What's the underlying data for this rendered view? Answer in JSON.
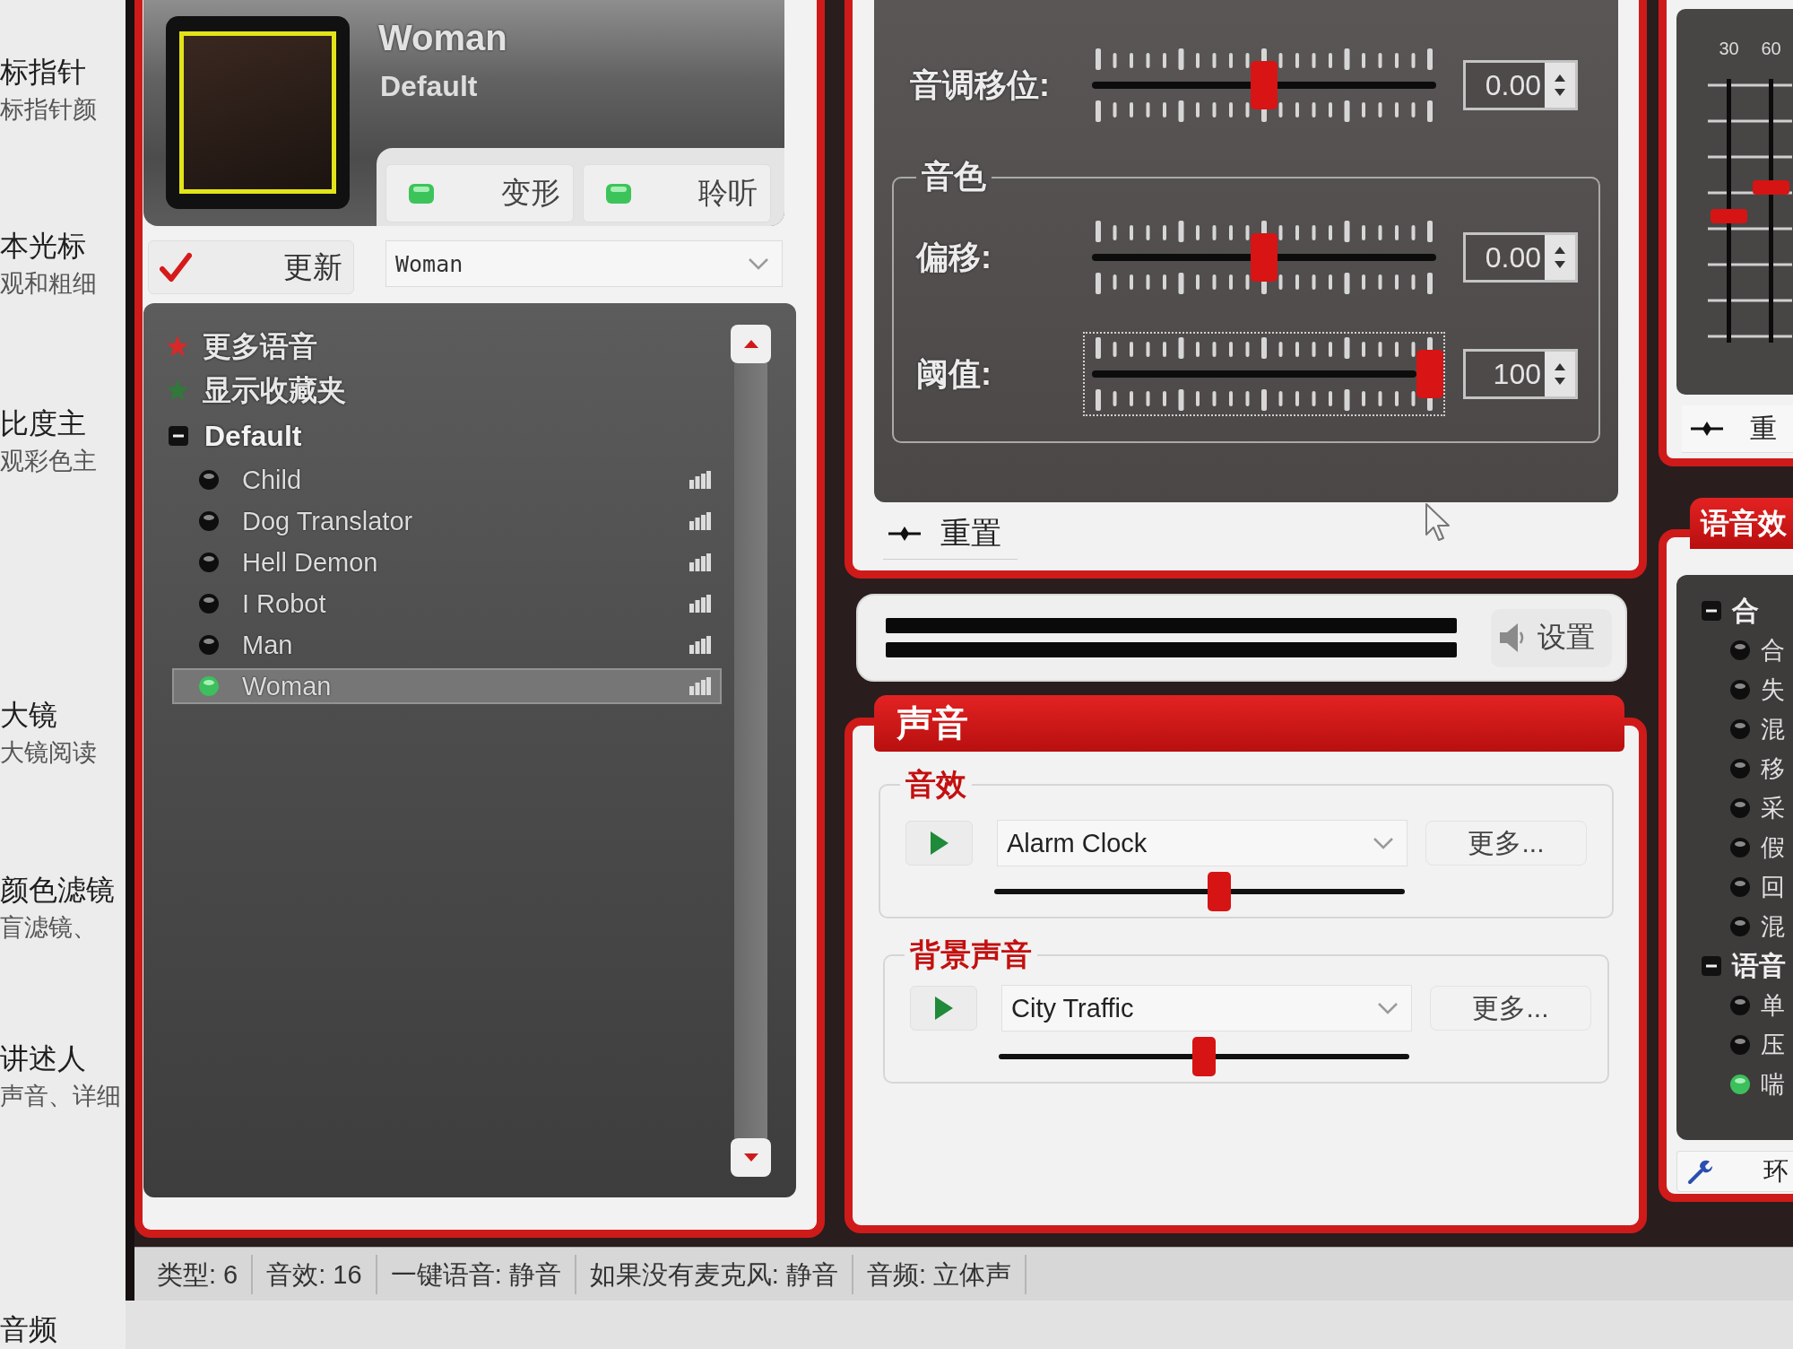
{
  "background_page": {
    "items": [
      {
        "title": "标指针",
        "subtitle": "标指针颜"
      },
      {
        "title": "本光标",
        "subtitle": "观和粗细"
      },
      {
        "title": "比度主",
        "subtitle": "观彩色主"
      },
      {
        "title": "大镜",
        "subtitle": "大镜阅读"
      },
      {
        "title": "颜色滤镜",
        "subtitle": "盲滤镜、"
      },
      {
        "title": "讲述人",
        "subtitle": "声音、详细"
      },
      {
        "title": "音频"
      }
    ]
  },
  "voice_header": {
    "title": "Woman",
    "subtitle": "Default",
    "buttons": [
      {
        "label": "变形",
        "on": true
      },
      {
        "label": "聆听",
        "on": true
      }
    ]
  },
  "update_button": {
    "label": "更新"
  },
  "voice_select": {
    "value": "Woman"
  },
  "voice_list": {
    "items": [
      {
        "kind": "link",
        "label": "更多语音",
        "color": "#d42a2a"
      },
      {
        "kind": "link",
        "label": "显示收藏夹",
        "color": "#2f7a3a"
      },
      {
        "kind": "group",
        "label": "Default",
        "expanded": true,
        "children": [
          {
            "label": "Child",
            "selected": false
          },
          {
            "label": "Dog Translator",
            "selected": false
          },
          {
            "label": "Hell Demon",
            "selected": false
          },
          {
            "label": "I Robot",
            "selected": false
          },
          {
            "label": "Man",
            "selected": false
          },
          {
            "label": "Woman",
            "selected": true
          }
        ]
      }
    ]
  },
  "pitch": {
    "label": "音调移位:",
    "level": 0.5,
    "value": "0.00",
    "focused": false
  },
  "timbre": {
    "title": "音色",
    "sliders": [
      {
        "label": "偏移:",
        "level": 0.5,
        "value": "0.00",
        "focused": false
      },
      {
        "label": "阈值:",
        "level": 1,
        "value": "100",
        "focused": true
      }
    ]
  },
  "reset_button": {
    "label": "重置"
  },
  "settings_button": {
    "label": "设置"
  },
  "sound": {
    "title": "声音",
    "groups": [
      {
        "title": "音效",
        "value": "Alarm Clock",
        "more": "更多...",
        "level": 0.55
      },
      {
        "title": "背景声音",
        "value": "City Traffic",
        "more": "更多...",
        "level": 0.5
      }
    ]
  },
  "right_panel": {
    "eq_bands": [
      {
        "label": "30",
        "level": 0.48
      },
      {
        "label": "60",
        "level": 0.59
      }
    ],
    "reset_label": "重",
    "tab": "语音效",
    "groups": [
      {
        "label": "合",
        "expanded": true,
        "children": [
          {
            "label": "合",
            "selected": false
          },
          {
            "label": "失",
            "selected": false
          },
          {
            "label": "混",
            "selected": false
          },
          {
            "label": "移",
            "selected": false
          },
          {
            "label": "采",
            "selected": false
          },
          {
            "label": "假",
            "selected": false
          },
          {
            "label": "回",
            "selected": false
          },
          {
            "label": "混",
            "selected": false
          }
        ]
      },
      {
        "label": "语音",
        "expanded": true,
        "children": [
          {
            "label": "单",
            "selected": false
          },
          {
            "label": "压",
            "selected": false
          },
          {
            "label": "喘",
            "selected": true
          }
        ]
      }
    ],
    "tool_label": "环"
  },
  "status_bar": [
    "类型: 6",
    "音效: 16",
    "一键语音: 静音",
    "如果没有麦克风: 静音",
    "音频: 立体声"
  ]
}
